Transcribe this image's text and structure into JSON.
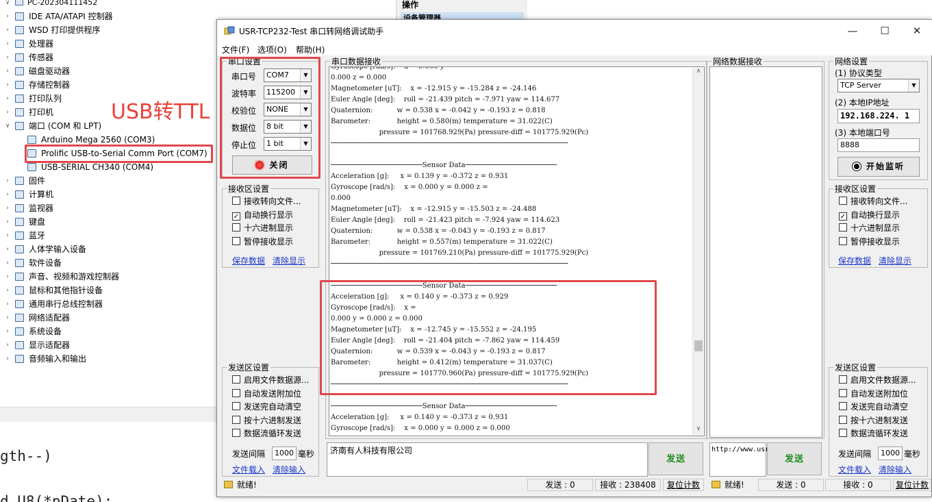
{
  "device_manager": {
    "computer_name": "PC-202304111452",
    "items": [
      {
        "label": "IDE ATA/ATAPI 控制器"
      },
      {
        "label": "WSD 打印提供程序"
      },
      {
        "label": "处理器"
      },
      {
        "label": "传感器"
      },
      {
        "label": "磁盘驱动器"
      },
      {
        "label": "存储控制器"
      },
      {
        "label": "打印队列"
      },
      {
        "label": "打印机"
      },
      {
        "label": "端口 (COM 和 LPT)"
      },
      {
        "label": "Arduino Mega 2560 (COM3)"
      },
      {
        "label": "Prolific USB-to-Serial Comm Port (COM7)"
      },
      {
        "label": "USB-SERIAL CH340 (COM4)"
      },
      {
        "label": "固件"
      },
      {
        "label": "计算机"
      },
      {
        "label": "监视器"
      },
      {
        "label": "键盘"
      },
      {
        "label": "蓝牙"
      },
      {
        "label": "人体学输入设备"
      },
      {
        "label": "软件设备"
      },
      {
        "label": "声音、视频和游戏控制器"
      },
      {
        "label": "鼠标和其他指针设备"
      },
      {
        "label": "通用串行总线控制器"
      },
      {
        "label": "网络适配器"
      },
      {
        "label": "系统设备"
      },
      {
        "label": "显示适配器"
      },
      {
        "label": "音频输入和输出"
      }
    ]
  },
  "actions_panel": {
    "title": "操作",
    "subtitle": "设备管理器"
  },
  "background_code": {
    "line1": "gth--)",
    "line2": "d U8(*pDate);"
  },
  "annotation": {
    "usb_label": "USB转TTL"
  },
  "app": {
    "title": "USR-TCP232-Test 串口转网络调试助手",
    "window_buttons": {
      "minimize": "—",
      "maximize": "☐",
      "close": "✕"
    },
    "menu": [
      "文件(F)",
      "选项(O)",
      "帮助(H)"
    ],
    "serial_settings": {
      "title": "串口设置",
      "port_label": "串口号",
      "port_value": "COM7",
      "baud_label": "波特率",
      "baud_value": "115200",
      "parity_label": "校验位",
      "parity_value": "NONE",
      "databits_label": "数据位",
      "databits_value": "8 bit",
      "stopbits_label": "停止位",
      "stopbits_value": "1 bit",
      "close_button": "关闭"
    },
    "recv_settings_left": {
      "title": "接收区设置",
      "options": [
        {
          "label": "接收转向文件...",
          "checked": ""
        },
        {
          "label": "自动换行显示",
          "checked": "✓"
        },
        {
          "label": "十六进制显示",
          "checked": ""
        },
        {
          "label": "暂停接收显示",
          "checked": ""
        }
      ],
      "save_link": "保存数据",
      "clear_link": "清除显示"
    },
    "send_settings_left": {
      "title": "发送区设置",
      "options": [
        {
          "label": "启用文件数据源..."
        },
        {
          "label": "自动发送附加位"
        },
        {
          "label": "发送完自动清空"
        },
        {
          "label": "按十六进制发送"
        },
        {
          "label": "数据流循环发送"
        }
      ],
      "interval_label": "发送间隔",
      "interval_value": "1000",
      "interval_unit": "毫秒",
      "load_link": "文件载入",
      "clear_link": "清除输入"
    },
    "serial_recv": {
      "title": "串口数据接收",
      "text": "Gyroscope [rad/s]:    x = 0.000 y =\n0.000 z = 0.000\nMagnetometer [uT]:    x = -12.915 y = -15.284 z = -24.146\nEuler Angle [deg]:    roll = -21.439 pitch = -7.971 yaw = 114.677\nQuaternion:           w = 0.538 x = -0.042 y = -0.193 z = 0.818\nBarometer:            height = 0.580(m) temperature = 31.022(C)\n                      pressure = 101768.929(Pa) pressure-diff = 101775.929(Pc)\n─────────────────────────────────────────────────────────\n\n──────────────────────Sensor Data──────────────────────\nAcceleration [g]:     x = 0.139 y = -0.372 z = 0.931\nGyroscope [rad/s]:    x = 0.000 y = 0.000 z =\n0.000\nMagnetometer [uT]:    x = -12.915 y = -15.503 z = -24.488\nEuler Angle [deg]:    roll = -21.423 pitch = -7.924 yaw = 114.623\nQuaternion:           w = 0.538 x = -0.043 y = -0.193 z = 0.817\nBarometer:            height = 0.557(m) temperature = 31.022(C)\n                      pressure = 101769.210(Pa) pressure-diff = 101775.929(Pc)\n─────────────────────────────────────────────────────────\n\n──────────────────────Sensor Data──────────────────────\nAcceleration [g]:     x = 0.140 y = -0.373 z = 0.929\nGyroscope [rad/s]:    x =\n0.000 y = 0.000 z = 0.000\nMagnetometer [uT]:    x = -12.745 y = -15.552 z = -24.195\nEuler Angle [deg]:    roll = -21.404 pitch = -7.862 yaw = 114.459\nQuaternion:           w = 0.539 x = -0.043 y = -0.193 z = 0.817\nBarometer:            height = 0.412(m) temperature = 31.037(C)\n                      pressure = 101770.960(Pa) pressure-diff = 101775.929(Pc)\n─────────────────────────────────────────────────────────\n\n──────────────────────Sensor Data──────────────────────\nAcceleration [g]:     x = 0.140 y = -0.373 z = 0.931\nGyroscope [rad/s]:    x = 0.000 y = 0.000 z = 0.000"
    },
    "net_recv": {
      "title": "网络数据接收"
    },
    "net_settings": {
      "title": "网络设置",
      "protocol_label": "(1) 协议类型",
      "protocol_value": "TCP Server",
      "ip_label": "(2) 本地IP地址",
      "ip_value": "192.168.224. 1",
      "port_label": "(3) 本地端口号",
      "port_value": "8888",
      "listen_button": "开始监听"
    },
    "recv_settings_right": {
      "title": "接收区设置",
      "options": [
        {
          "label": "接收转向文件...",
          "checked": ""
        },
        {
          "label": "自动换行显示",
          "checked": "✓"
        },
        {
          "label": "十六进制显示",
          "checked": ""
        },
        {
          "label": "暂停接收显示",
          "checked": ""
        }
      ],
      "save_link": "保存数据",
      "clear_link": "清除显示"
    },
    "send_settings_right": {
      "title": "发送区设置",
      "options": [
        {
          "label": "启用文件数据源..."
        },
        {
          "label": "自动发送附加位"
        },
        {
          "label": "发送完自动清空"
        },
        {
          "label": "按十六进制发送"
        },
        {
          "label": "数据流循环发送"
        }
      ],
      "interval_label": "发送间隔",
      "interval_value": "1000",
      "interval_unit": "毫秒",
      "load_link": "文件载入",
      "clear_link": "清除输入"
    },
    "serial_send": {
      "text": "济南有人科技有限公司",
      "button": "发送"
    },
    "net_send": {
      "text": "http://www.usr.cn",
      "button": "发送"
    },
    "status_left": {
      "ready": "就绪!",
      "sent": "发送 : 0",
      "received": "接收 : 238408",
      "reset": "复位计数"
    },
    "status_right": {
      "ready": "就绪!",
      "sent": "发送 : 0",
      "received": "接收 : 0",
      "reset": "复位计数"
    }
  }
}
